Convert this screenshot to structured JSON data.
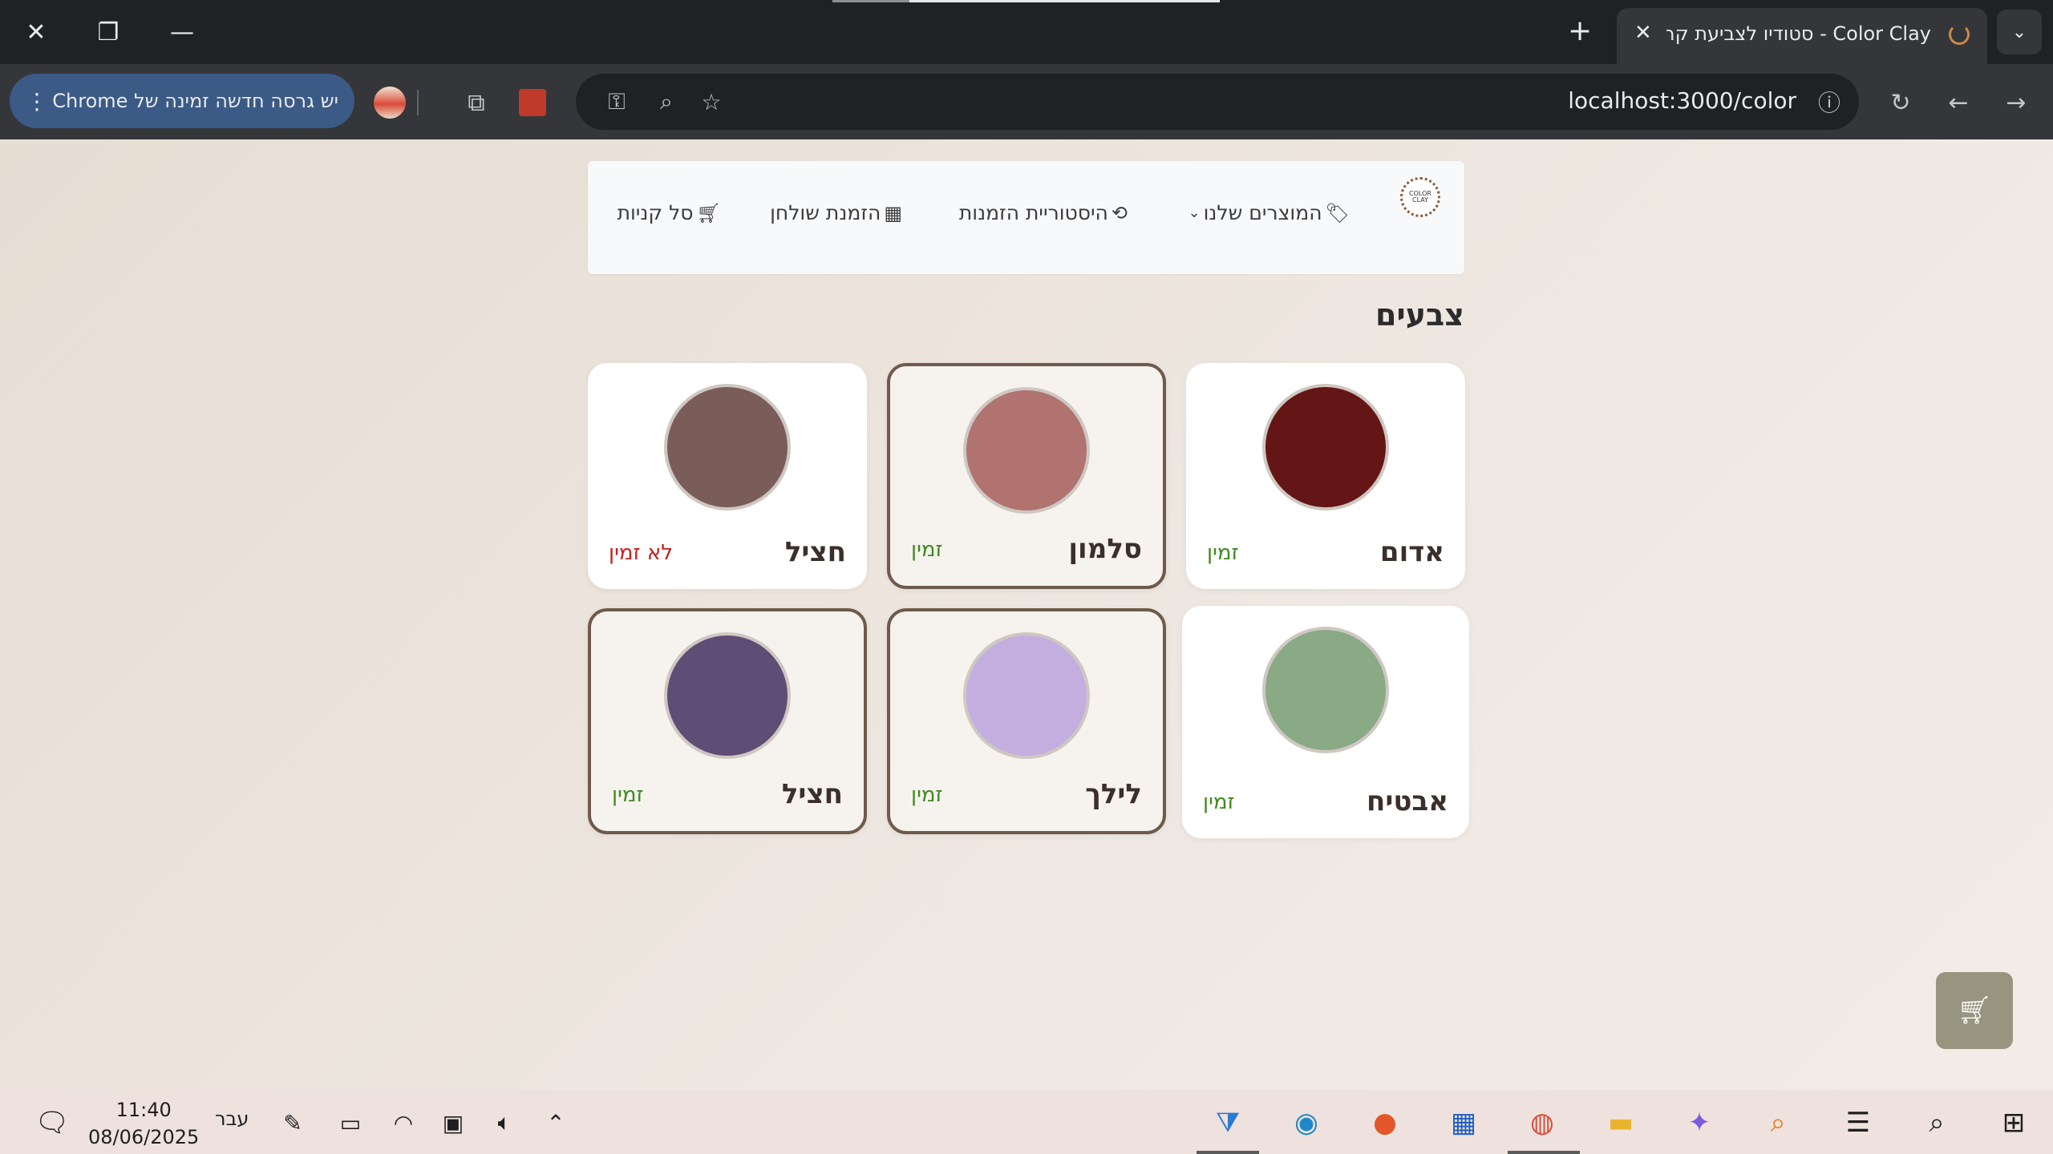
{
  "browser": {
    "tab_title": "Color Clay - סטודיו לצביעת קרמיקה",
    "tab_close": "✕",
    "new_tab": "+",
    "url": "localhost:3000/color",
    "update_banner": "יש גרסה חדשה זמינה של Chrome"
  },
  "nav": {
    "logo_text": "COLOR CLAY",
    "products": "המוצרים שלנו",
    "history": "היסטוריית הזמנות",
    "table_booking": "הזמנת שולחן",
    "cart": "סל קניות"
  },
  "page": {
    "heading": "צבעים"
  },
  "colors": [
    {
      "name": "אדום",
      "status": "זמין",
      "available": true,
      "hex": "#641616",
      "selected": false
    },
    {
      "name": "סלמון",
      "status": "זמין",
      "available": true,
      "hex": "#b07370",
      "selected": true
    },
    {
      "name": "חציל",
      "status": "לא זמין",
      "available": false,
      "hex": "#7a5c58",
      "selected": false
    },
    {
      "name": "אבטיח",
      "status": "זמין",
      "available": true,
      "hex": "#8aa985",
      "selected": false
    },
    {
      "name": "לילך",
      "status": "זמין",
      "available": true,
      "hex": "#c4aee0",
      "selected": true
    },
    {
      "name": "חציל",
      "status": "זמין",
      "available": true,
      "hex": "#5e4d74",
      "selected": true
    }
  ],
  "taskbar": {
    "time": "11:40",
    "date": "08/06/2025",
    "language": "עבר"
  },
  "theme": {
    "available_color": "#3f8a1f",
    "unavailable_color": "#c81e1e",
    "selected_border": "#6f5a4b"
  }
}
